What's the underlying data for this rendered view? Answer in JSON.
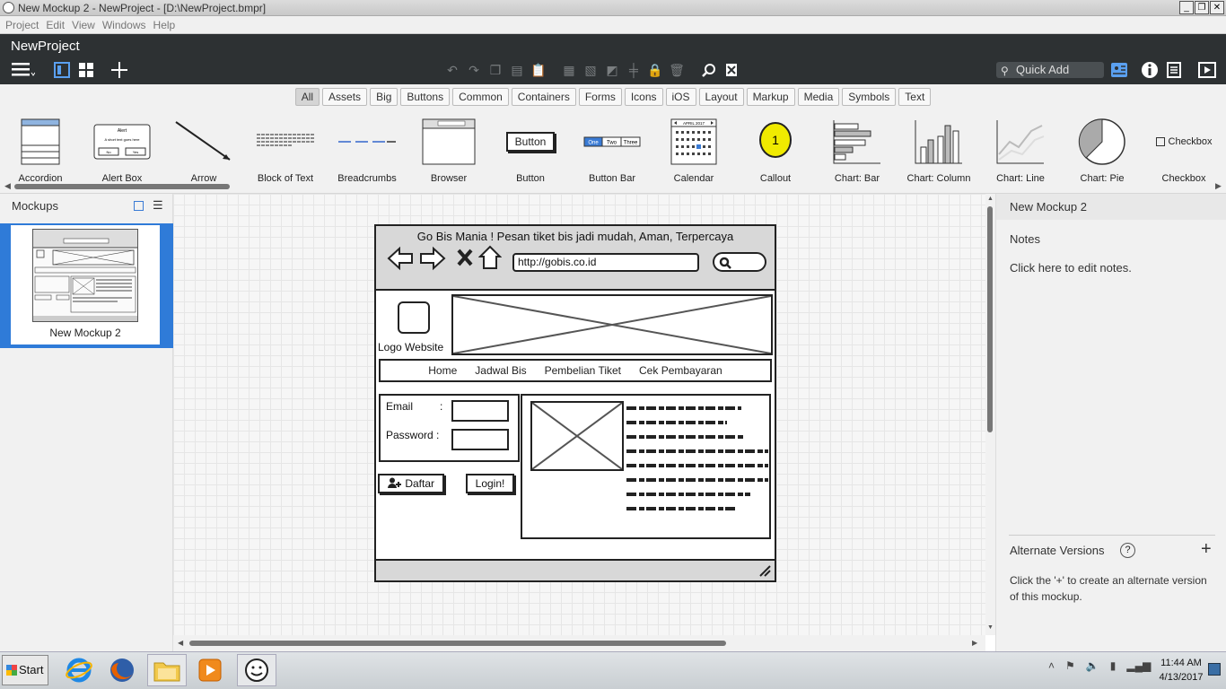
{
  "window": {
    "title": "New Mockup 2 - NewProject - [D:\\NewProject.bmpr]",
    "controls": [
      "_",
      "❐",
      "✕"
    ]
  },
  "menu": [
    "Project",
    "Edit",
    "View",
    "Windows",
    "Help"
  ],
  "project_name": "NewProject",
  "quick_add": "Quick Add",
  "categories": [
    {
      "label": "All",
      "active": true
    },
    {
      "label": "Assets"
    },
    {
      "label": "Big"
    },
    {
      "label": "Buttons"
    },
    {
      "label": "Common"
    },
    {
      "label": "Containers"
    },
    {
      "label": "Forms"
    },
    {
      "label": "Icons"
    },
    {
      "label": "iOS"
    },
    {
      "label": "Layout"
    },
    {
      "label": "Markup"
    },
    {
      "label": "Media"
    },
    {
      "label": "Symbols"
    },
    {
      "label": "Text"
    }
  ],
  "library": [
    "Accordion",
    "Alert Box",
    "Arrow",
    "Block of Text",
    "Breadcrumbs",
    "Browser",
    "Button",
    "Button Bar",
    "Calendar",
    "Callout",
    "Chart: Bar",
    "Chart: Column",
    "Chart: Line",
    "Chart: Pie",
    "Checkbox"
  ],
  "library_thumbs": {
    "button": "Button",
    "checkbox": "Checkbox",
    "callout": "1",
    "alert_title": "Alert",
    "alert_text": "A short text goes here",
    "alert_no": "No",
    "alert_yes": "Yes",
    "calendar_month": "APRIL 2017",
    "button_bar": [
      "One",
      "Two",
      "Three"
    ]
  },
  "mockups_panel": {
    "title": "Mockups",
    "items": [
      {
        "label": "New Mockup 2"
      }
    ]
  },
  "right_panel": {
    "title": "New Mockup 2",
    "notes_label": "Notes",
    "notes_placeholder": "Click here to edit notes.",
    "alt_title": "Alternate Versions",
    "alt_help": "?",
    "alt_add": "+",
    "alt_desc": "Click the '+' to create an alternate version of this mockup."
  },
  "wireframe": {
    "title": "Go Bis Mania ! Pesan tiket bis jadi mudah, Aman, Terpercaya",
    "url": "http://gobis.co.id",
    "logo_text": "Logo Website",
    "nav": [
      "Home",
      "Jadwal Bis",
      "Pembelian Tiket",
      "Cek Pembayaran"
    ],
    "email_label": "Email",
    "password_label": "Password :",
    "colon": ":",
    "register_button": "Daftar",
    "login_button": "Login!"
  },
  "taskbar": {
    "start": "Start",
    "time": "11:44 AM",
    "date": "4/13/2017"
  }
}
